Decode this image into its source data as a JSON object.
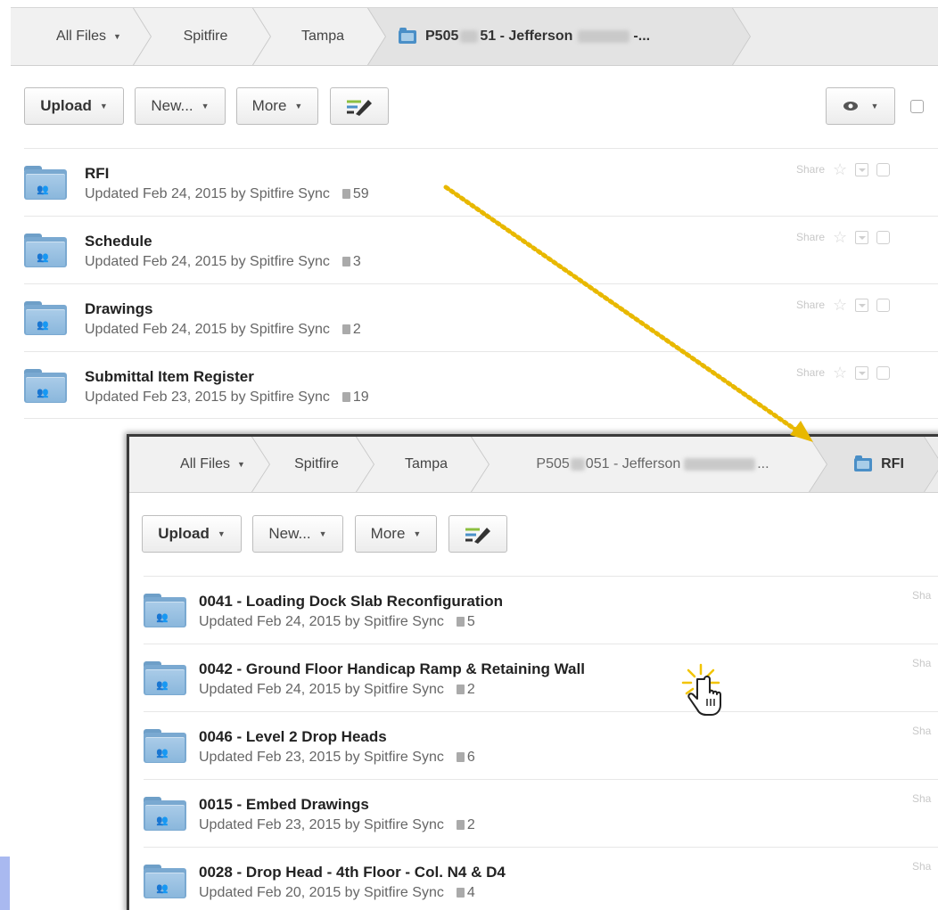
{
  "main": {
    "breadcrumb": [
      {
        "label": "All Files",
        "dropdown": true
      },
      {
        "label": "Spitfire"
      },
      {
        "label": "Tampa"
      },
      {
        "label_prefix": "P505",
        "label_suffix": "51 - Jefferson",
        "label_end": "-...",
        "active": true,
        "icon": "folder-icon"
      }
    ],
    "toolbar": {
      "upload_label": "Upload",
      "new_label": "New...",
      "more_label": "More",
      "edit_icon": "pen-icon",
      "view_icon": "eye-icon"
    },
    "rows": [
      {
        "title": "RFI",
        "meta": "Updated Feb 24, 2015 by Spitfire Sync",
        "count": "59",
        "share": "Share"
      },
      {
        "title": "Schedule",
        "meta": "Updated Feb 24, 2015 by Spitfire Sync",
        "count": "3",
        "share": "Share"
      },
      {
        "title": "Drawings",
        "meta": "Updated Feb 24, 2015 by Spitfire Sync",
        "count": "2",
        "share": "Share"
      },
      {
        "title": "Submittal Item Register",
        "meta": "Updated Feb 23, 2015 by Spitfire Sync",
        "count": "19",
        "share": "Share"
      }
    ]
  },
  "inset": {
    "breadcrumb": [
      {
        "label": "All Files",
        "dropdown": true
      },
      {
        "label": "Spitfire"
      },
      {
        "label": "Tampa"
      },
      {
        "label_prefix": "P505",
        "label_suffix": "051 - Jefferson",
        "label_end": "..."
      },
      {
        "label": "RFI",
        "active": true,
        "icon": "folder-icon"
      }
    ],
    "toolbar": {
      "upload_label": "Upload",
      "new_label": "New...",
      "more_label": "More"
    },
    "rows": [
      {
        "title": "0041 - Loading Dock Slab Reconfiguration",
        "meta": "Updated Feb 24, 2015 by Spitfire Sync",
        "count": "5",
        "share": "Sha"
      },
      {
        "title": "0042 - Ground Floor Handicap Ramp & Retaining Wall",
        "meta": "Updated Feb 24, 2015 by Spitfire Sync",
        "count": "2",
        "share": "Sha"
      },
      {
        "title": "0046 - Level 2 Drop Heads",
        "meta": "Updated Feb 23, 2015 by Spitfire Sync",
        "count": "6",
        "share": "Sha"
      },
      {
        "title": "0015 - Embed Drawings",
        "meta": "Updated Feb 23, 2015 by Spitfire Sync",
        "count": "2",
        "share": "Sha"
      },
      {
        "title": "0028 - Drop Head - 4th Floor - Col. N4 & D4",
        "meta": "Updated Feb 20, 2015 by Spitfire Sync",
        "count": "4",
        "share": "Sha"
      }
    ]
  },
  "colors": {
    "arrow": "#e8b800",
    "folder": "#7aa9d1",
    "crumb_bg": "#f1f1f1"
  },
  "cursor_icon": "hand-pointer-icon"
}
